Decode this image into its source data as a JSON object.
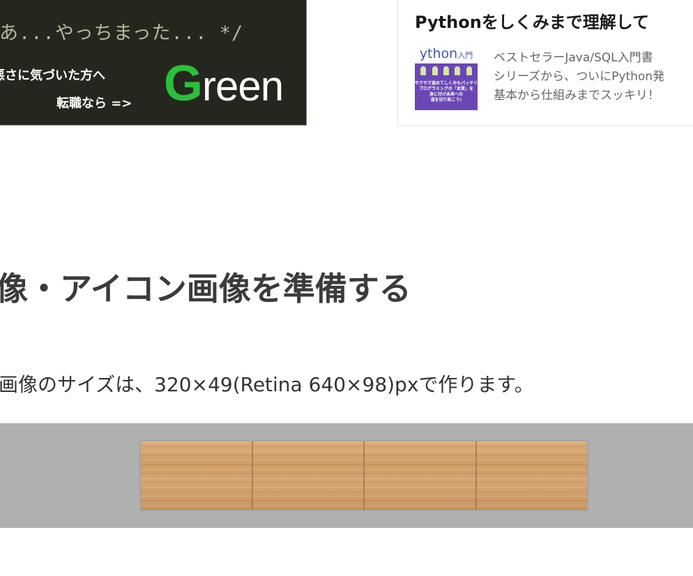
{
  "ad": {
    "code_line": "あ...やっちまった... */",
    "line1": "悪さに気づいた方へ",
    "line2": "転職なら =>",
    "logo_accent": "G",
    "logo_rest": "reen",
    "colors": {
      "background": "#25271f",
      "accent": "#2cbf3c"
    }
  },
  "book": {
    "title": "Pythonをしくみまで理解して",
    "cover_title": "ython",
    "cover_subtitle": "入門",
    "cover_blurb_1": "サクサク進めてしくみもバッチリ!",
    "cover_blurb_2": "プログラミングの「本質」を",
    "cover_blurb_3": "身に付け未来への",
    "cover_blurb_4": "道を切り拓こう!",
    "desc_line1": "ベストセラーJava/SQL入門書",
    "desc_line2": "シリーズから、ついにPython発",
    "desc_line3": "基本から仕組みまでスッキリ！",
    "colors": {
      "cover": "#6b47b5"
    }
  },
  "article": {
    "heading": "像・アイコン画像を準備する",
    "paragraph": "画像のサイズは、320×49(Retina 640×98)pxで作ります。",
    "tiles_count": 4,
    "colors": {
      "stage": "#b0b0b0",
      "wood": "#d6a673"
    }
  }
}
